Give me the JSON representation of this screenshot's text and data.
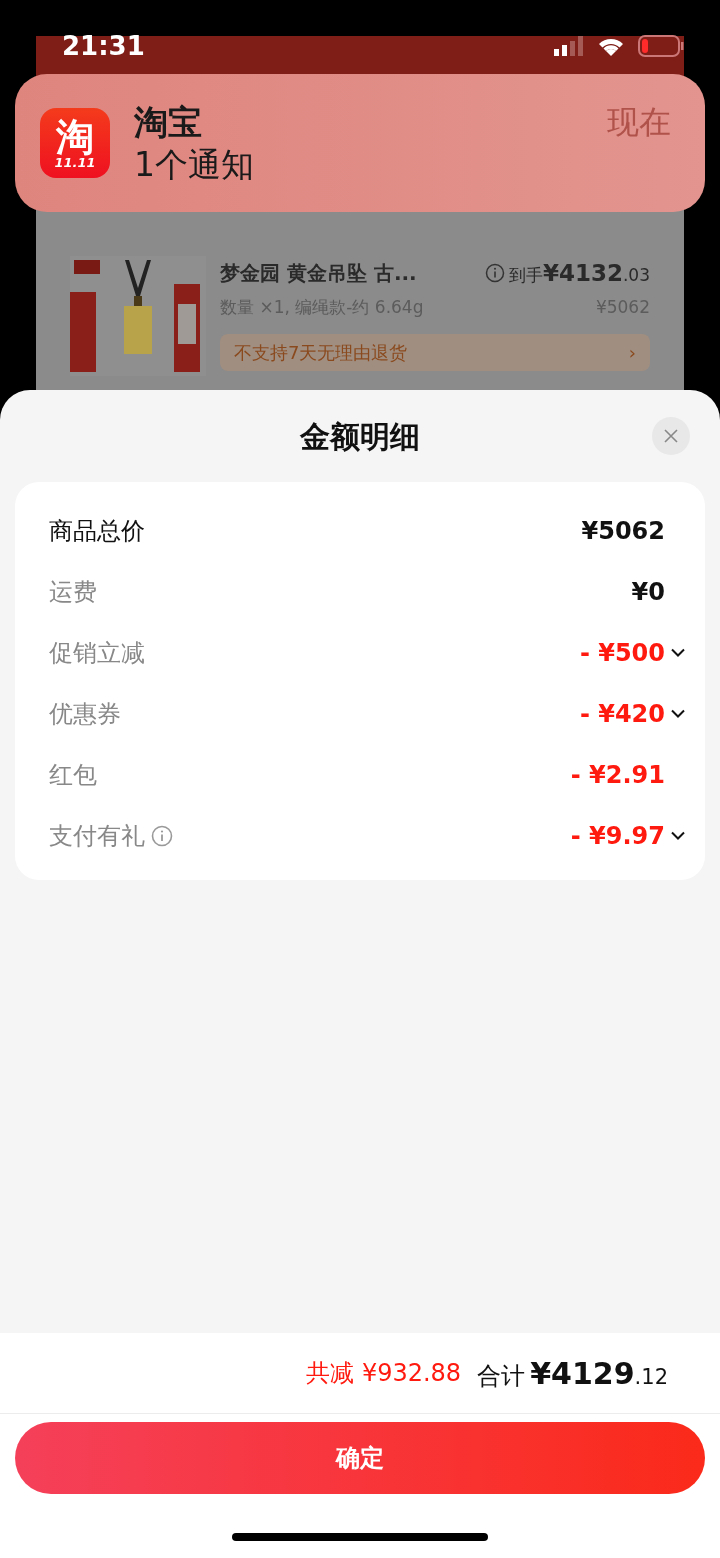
{
  "status_bar": {
    "time": "21:31",
    "battery_low": true
  },
  "notification": {
    "app_icon": {
      "glyph": "淘",
      "badge": "11.11"
    },
    "app": "淘宝",
    "message": "1个通知",
    "time": "现在"
  },
  "background_order": {
    "product": {
      "title": "梦金园 黄金吊坠 古...",
      "price_label": "到手",
      "price": "¥4132",
      "price_fraction": ".03",
      "spec": "数量 ×1, 编绳款-约 6.64g",
      "original_price": "¥5062",
      "notice": "不支持7天无理由退货",
      "notice_arrow": "›"
    }
  },
  "sheet": {
    "title": "金额明细",
    "rows": [
      {
        "label": "商品总价",
        "value": "¥5062",
        "emphasis": true,
        "negative": false,
        "expandable": false,
        "info": false
      },
      {
        "label": "运费",
        "value": "¥0",
        "emphasis": false,
        "negative": false,
        "expandable": false,
        "info": false
      },
      {
        "label": "促销立减",
        "value": "- ¥500",
        "emphasis": false,
        "negative": true,
        "expandable": true,
        "info": false
      },
      {
        "label": "优惠券",
        "value": "- ¥420",
        "emphasis": false,
        "negative": true,
        "expandable": true,
        "info": false
      },
      {
        "label": "红包",
        "value": "- ¥2.91",
        "emphasis": false,
        "negative": true,
        "expandable": false,
        "info": false
      },
      {
        "label": "支付有礼",
        "value": "- ¥9.97",
        "emphasis": false,
        "negative": true,
        "expandable": true,
        "info": true
      }
    ],
    "summary": {
      "saving": "共减 ¥932.88",
      "total_label": "合计",
      "total": "¥4129",
      "total_fraction": ".12"
    },
    "confirm_button": "确定"
  }
}
